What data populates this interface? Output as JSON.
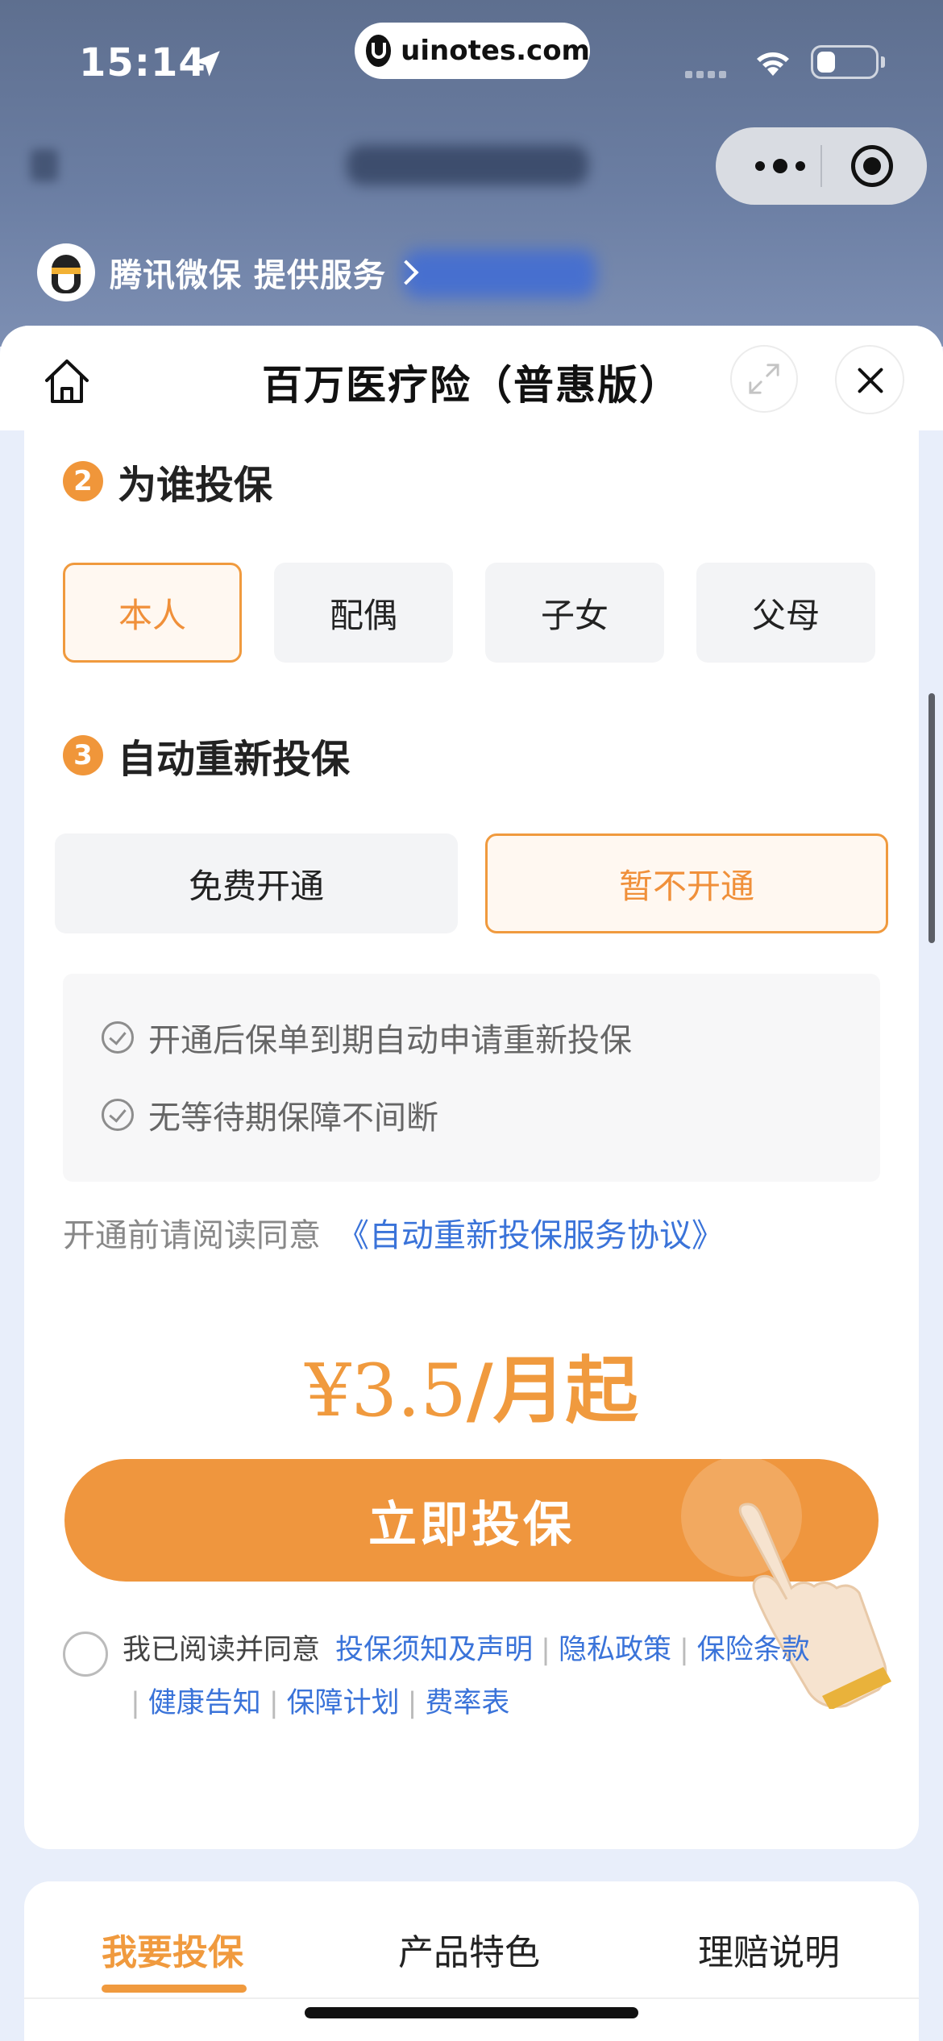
{
  "status_bar": {
    "time": "15:14",
    "url": "uinotes.com",
    "battery_level": 0.3
  },
  "provider": {
    "text": "腾讯微保 提供服务"
  },
  "sheet": {
    "title": "百万医疗险（普惠版）"
  },
  "section_insured": {
    "number": "2",
    "title": "为谁投保",
    "options": [
      {
        "label": "本人",
        "selected": true
      },
      {
        "label": "配偶",
        "selected": false
      },
      {
        "label": "子女",
        "selected": false
      },
      {
        "label": "父母",
        "selected": false
      }
    ]
  },
  "section_renew": {
    "number": "3",
    "title": "自动重新投保",
    "options": [
      {
        "label": "免费开通",
        "selected": false
      },
      {
        "label": "暂不开通",
        "selected": true
      }
    ],
    "benefits": [
      "开通后保单到期自动申请重新投保",
      "无等待期保障不间断"
    ],
    "agree_prefix": "开通前请阅读同意",
    "agree_link": "《自动重新投保服务协议》"
  },
  "price": {
    "amount": "¥3.5",
    "unit": "/月起"
  },
  "cta": {
    "label": "立即投保"
  },
  "terms": {
    "prefix": "我已阅读并同意",
    "links": [
      "投保须知及声明",
      "隐私政策",
      "保险条款",
      "健康告知",
      "保障计划",
      "费率表"
    ],
    "separator": "|"
  },
  "tabs": [
    {
      "label": "我要投保",
      "active": true
    },
    {
      "label": "产品特色",
      "active": false
    },
    {
      "label": "理赔说明",
      "active": false
    }
  ],
  "colors": {
    "accent": "#f09a3e",
    "link": "#3a73d9"
  }
}
